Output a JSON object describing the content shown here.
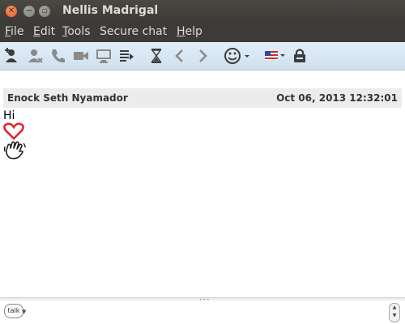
{
  "window": {
    "title": "Nellis Madrigal"
  },
  "menu": {
    "file": {
      "u": "F",
      "rest": "ile"
    },
    "edit": {
      "u": "E",
      "rest": "dit"
    },
    "tools": {
      "u": "T",
      "rest": "ools"
    },
    "secure": {
      "pre": "Secure chat"
    },
    "help": {
      "u": "H",
      "rest": "elp"
    }
  },
  "toolbar": {
    "icons": [
      "add-contact-icon",
      "block-contact-icon",
      "phone-icon",
      "video-call-icon",
      "screen-share-icon",
      "send-file-icon",
      "history-icon",
      "back-icon",
      "forward-icon",
      "smiley-icon",
      "language-flag-icon",
      "lock-icon"
    ]
  },
  "conversation": {
    "sender": "Enock Seth Nyamador",
    "timestamp": "Oct 06, 2013 12:32:01",
    "message": "Hi",
    "emoticons": [
      "heart-icon",
      "waving-hand-icon"
    ]
  },
  "input": {
    "service": "talk",
    "value": ""
  },
  "colors": {
    "titlebar": "#3c3b37",
    "toolbar": "#d8e7f3",
    "close": "#e25a22",
    "heart": "#e0272a"
  }
}
